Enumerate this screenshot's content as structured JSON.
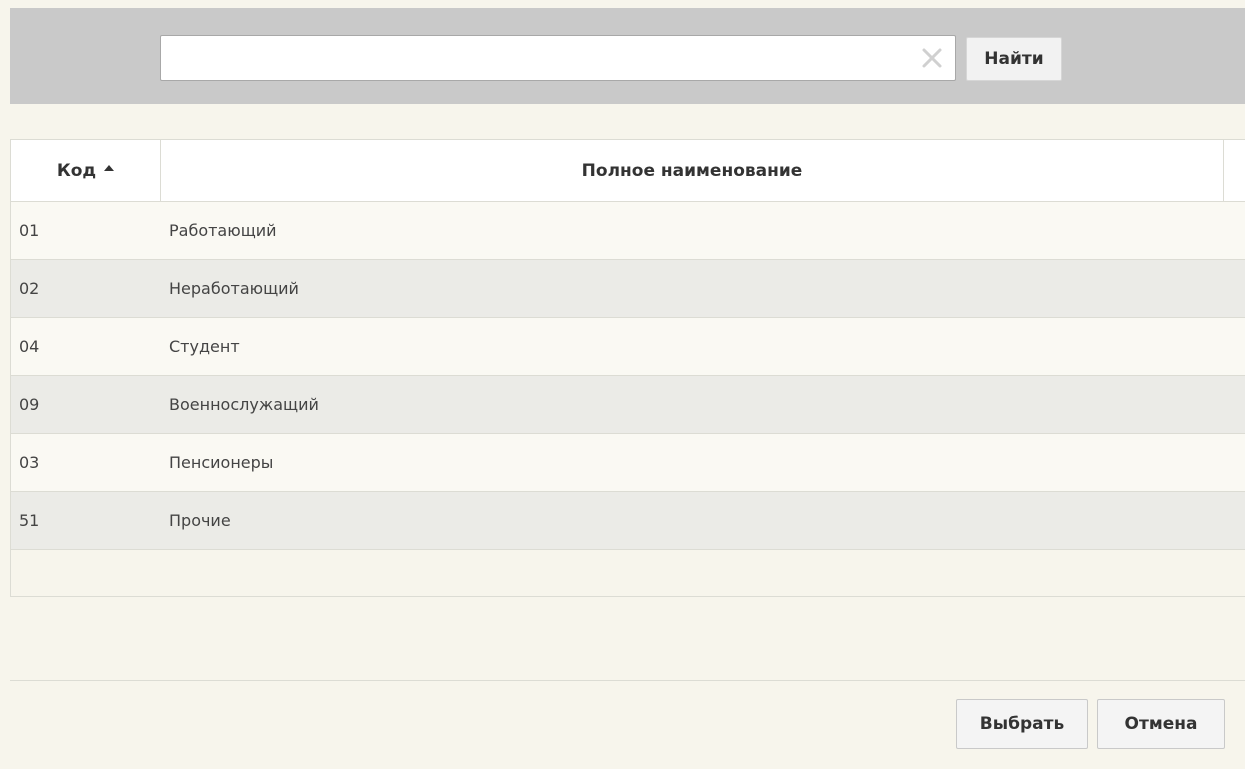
{
  "search": {
    "value": "",
    "placeholder": "",
    "find_label": "Найти"
  },
  "table": {
    "columns": [
      {
        "label": "Код",
        "sort": "ascending"
      },
      {
        "label": "Полное наименование"
      }
    ],
    "rows": [
      {
        "code": "01",
        "name": "Работающий"
      },
      {
        "code": "02",
        "name": "Неработающий"
      },
      {
        "code": "04",
        "name": "Студент"
      },
      {
        "code": "09",
        "name": "Военнослужащий"
      },
      {
        "code": "03",
        "name": "Пенсионеры"
      },
      {
        "code": "51",
        "name": "Прочие"
      }
    ]
  },
  "footer": {
    "select_label": "Выбрать",
    "cancel_label": "Отмена"
  },
  "icons": {
    "clear": "close-icon",
    "sort": "sort-ascending-icon"
  },
  "colors": {
    "background": "#f7f5ec",
    "search_bar": "#c9c9c9",
    "row_alt": "#ebebe7"
  }
}
